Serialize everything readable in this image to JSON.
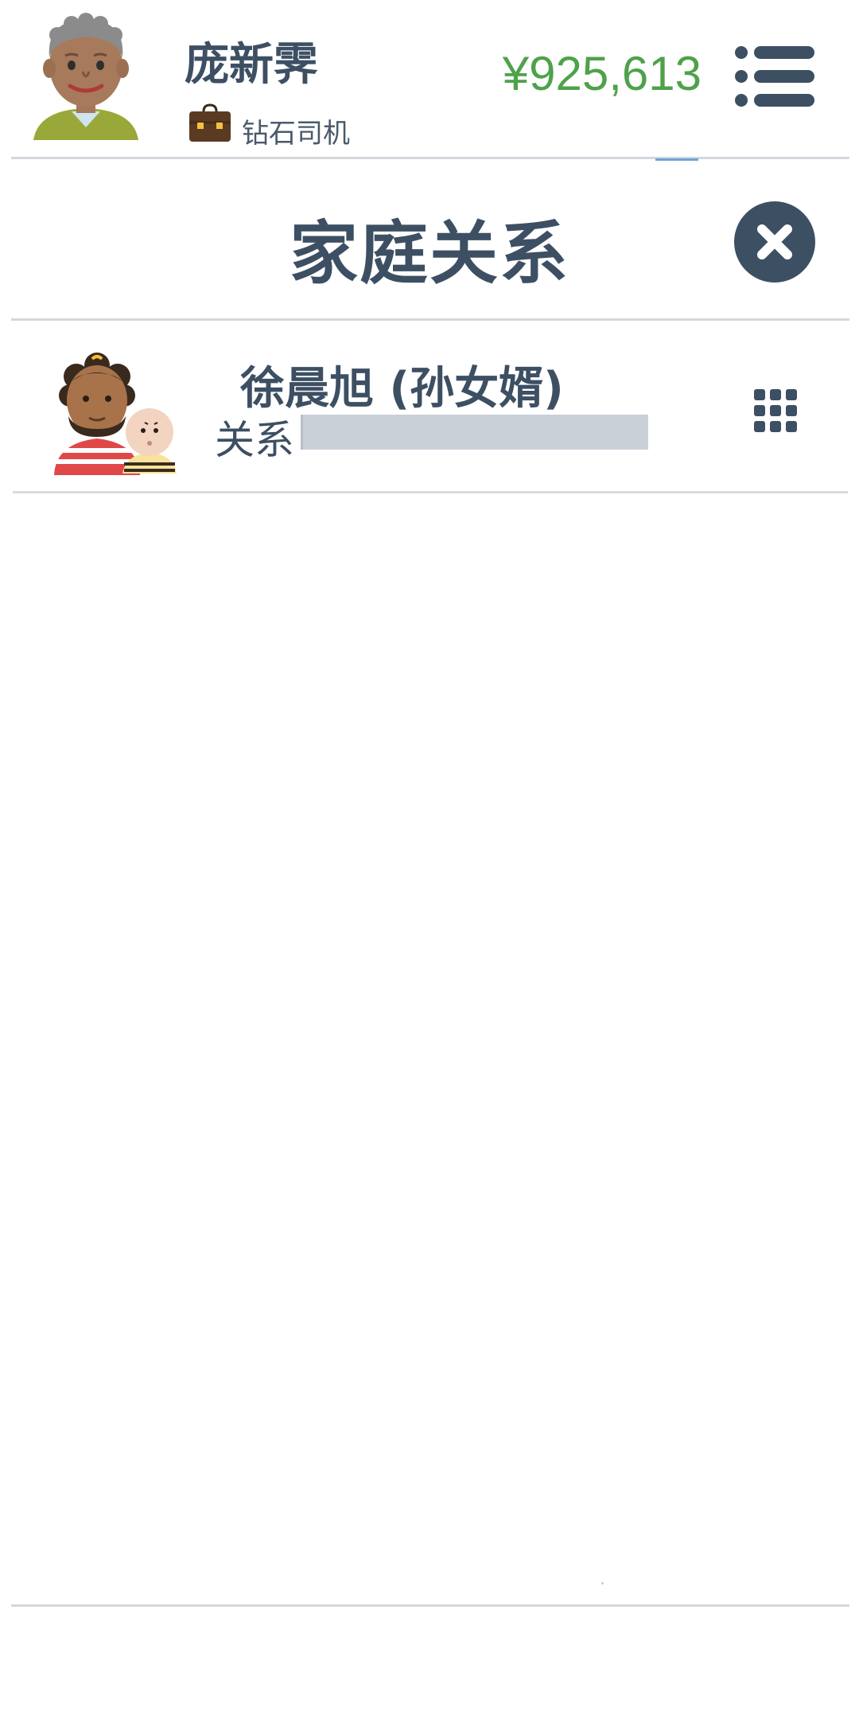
{
  "header": {
    "player_name": "庞新霁",
    "job_title": "钻石司机",
    "balance": "¥925,613",
    "avatar_icon": "elderly-man-avatar-icon",
    "job_icon": "briefcase-icon",
    "menu_icon": "list-menu-icon"
  },
  "page": {
    "title": "家庭关系",
    "close_icon": "close-icon"
  },
  "relations": [
    {
      "name": "徐晨旭 (孙女婿)",
      "relation_label": "关系",
      "relation_level": 0,
      "avatar_icon": "man-with-baby-avatar-icon",
      "action_icon": "grid-icon"
    }
  ],
  "colors": {
    "text_primary": "#3d4f63",
    "balance_green": "#4ea24a",
    "bar_track": "#c9d0d8",
    "divider": "#d4d8dc",
    "accent_blue": "#6fa3d6"
  }
}
